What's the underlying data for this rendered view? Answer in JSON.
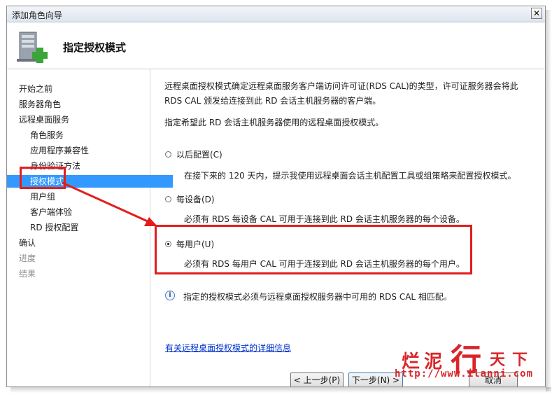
{
  "window": {
    "title": "添加角色向导",
    "close_label": "✕",
    "page_title": "指定授权模式"
  },
  "sidebar": {
    "items": [
      {
        "label": "开始之前",
        "level": "top",
        "state": "normal"
      },
      {
        "label": "服务器角色",
        "level": "top",
        "state": "normal"
      },
      {
        "label": "远程桌面服务",
        "level": "top",
        "state": "normal"
      },
      {
        "label": "角色服务",
        "level": "sub",
        "state": "normal"
      },
      {
        "label": "应用程序兼容性",
        "level": "sub",
        "state": "normal"
      },
      {
        "label": "身份验证方法",
        "level": "sub",
        "state": "normal"
      },
      {
        "label": "授权模式",
        "level": "sub",
        "state": "selected"
      },
      {
        "label": "用户组",
        "level": "sub",
        "state": "normal"
      },
      {
        "label": "客户端体验",
        "level": "sub",
        "state": "normal"
      },
      {
        "label": "RD 授权配置",
        "level": "sub",
        "state": "normal"
      },
      {
        "label": "确认",
        "level": "top",
        "state": "normal"
      },
      {
        "label": "进度",
        "level": "top",
        "state": "disabled"
      },
      {
        "label": "结果",
        "level": "top",
        "state": "disabled"
      }
    ]
  },
  "content": {
    "intro_line1": "远程桌面授权模式确定远程桌面服务客户端访问许可证(RDS CAL)的类型，许可证服务器会将此",
    "intro_line2": "RDS CAL 颁发给连接到此 RD 会话主机服务器的客户端。",
    "instruction": "指定希望此 RD 会话主机服务器使用的远程桌面授权模式。",
    "options": [
      {
        "label": "以后配置(C)",
        "description": "在接下来的 120 天内，提示我使用远程桌面会话主机配置工具或组策略来配置授权模式。",
        "checked": false
      },
      {
        "label": "每设备(D)",
        "description": "必须有 RDS 每设备 CAL 可用于连接到此 RD 会话主机服务器的每个设备。",
        "checked": false
      },
      {
        "label": "每用户(U)",
        "description": "必须有 RDS 每用户 CAL 可用于连接到此 RD 会话主机服务器的每个用户。",
        "checked": true
      }
    ],
    "info_text": "指定的授权模式必须与远程桌面授权服务器中可用的 RDS CAL 相匹配。",
    "info_icon": "i",
    "help_link": "有关远程桌面授权模式的详细信息"
  },
  "buttons": {
    "back": "< 上一步(P)",
    "next": "下一步(N) >",
    "cancel": "取消"
  },
  "watermark": {
    "chars": "烂泥行天下",
    "url": "http://www.ilanni.com"
  },
  "colors": {
    "highlight": "#3399ff",
    "annotation_red": "#e31d1d",
    "link": "#0033cc"
  }
}
